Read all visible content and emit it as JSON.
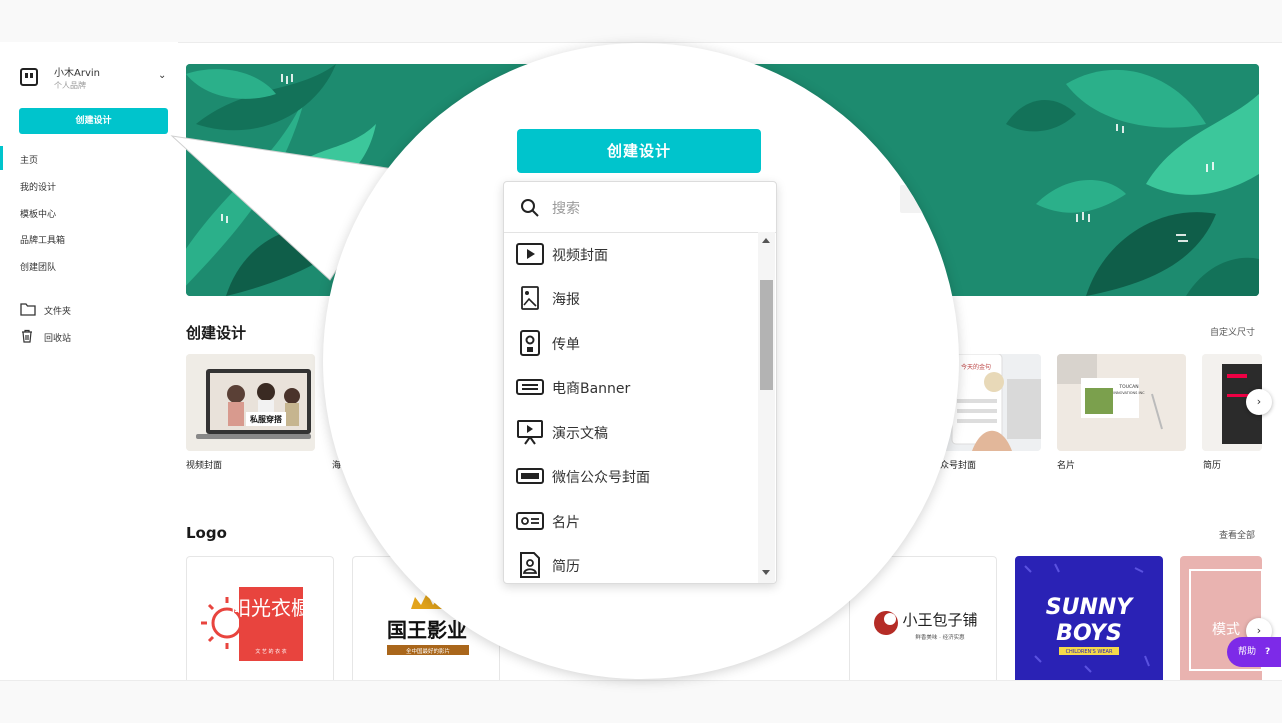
{
  "sidebar": {
    "brand_name": "小木Arvin",
    "brand_sub": "个人品牌",
    "create_label": "创建设计",
    "nav": [
      "主页",
      "我的设计",
      "模板中心",
      "品牌工具箱",
      "创建团队"
    ],
    "folders": [
      "文件夹",
      "回收站"
    ]
  },
  "main": {
    "create_section_title": "创建设计",
    "custom_size_label": "自定义尺寸",
    "cards": [
      {
        "label": "视频封面"
      },
      {
        "label": "海"
      },
      {
        "label": "众号封面"
      },
      {
        "label": "名片"
      },
      {
        "label": "简历"
      }
    ],
    "logo_section_title": "Logo",
    "view_all_label": "查看全部",
    "logos": {
      "sunshine_title": "阳光衣橱",
      "sunshine_sub": "文 艺 的 衣 衣",
      "king_title": "国王影业",
      "king_sub": "全中国最好的影片",
      "bun_title": "小王包子铺",
      "bun_sub": "鲜香美味 · 经济实惠",
      "sunny_title_1": "SUNNY",
      "sunny_title_2": "BOYS",
      "sunny_sub": "CHILDREN'S WEAR",
      "last_text": "模式"
    },
    "card_texts": {
      "fashion_tag": "私服穿搭",
      "toucan_line1": "TOUCAN",
      "toucan_line2": "INNOVATIONS INC",
      "wechat_tag": "今天的金句"
    }
  },
  "help": {
    "label": "帮助",
    "icon": "?"
  },
  "magnifier": {
    "create_label": "创建设计",
    "search_placeholder": "搜索",
    "items": [
      {
        "label": "视频封面",
        "icon": "video-play-icon"
      },
      {
        "label": "海报",
        "icon": "poster-icon"
      },
      {
        "label": "传单",
        "icon": "flyer-icon"
      },
      {
        "label": "电商Banner",
        "icon": "banner-icon"
      },
      {
        "label": "演示文稿",
        "icon": "presentation-icon"
      },
      {
        "label": "微信公众号封面",
        "icon": "wechat-cover-icon"
      },
      {
        "label": "名片",
        "icon": "business-card-icon"
      },
      {
        "label": "简历",
        "icon": "resume-icon"
      }
    ]
  },
  "colors": {
    "accent": "#00c4cc",
    "banner": "#1d8b6f",
    "help": "#7d2ae8"
  }
}
